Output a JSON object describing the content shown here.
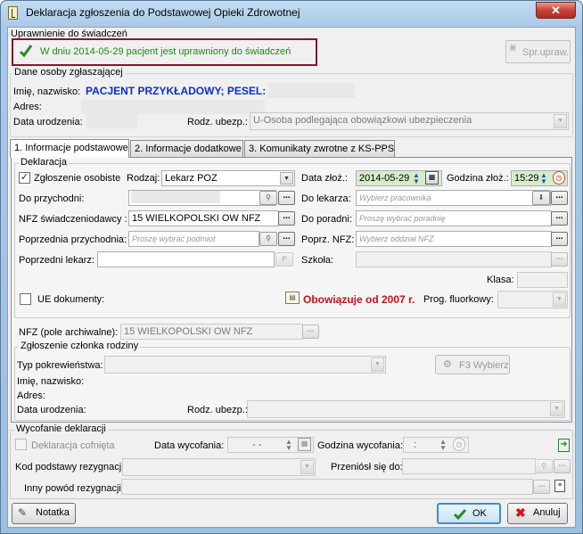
{
  "window": {
    "title": "Deklaracja zgłoszenia do Podstawowej Opieki Zdrowotnej",
    "close": "✕"
  },
  "uprawnienie": {
    "group": "Uprawnienie do świadczeń",
    "message": "W dniu 2014-05-29 pacjent jest uprawniony do świadczeń",
    "spr_button": "Spr.upraw."
  },
  "osoba": {
    "group": "Dane osoby zgłaszającej",
    "name_label": "Imię, nazwisko:",
    "name_value": "PACJENT PRZYKŁADOWY; PESEL:",
    "adres_label": "Adres:",
    "dob_label": "Data urodzenia:",
    "rodz_label": "Rodz. ubezp.:",
    "rodz_value": "U-Osoba podlegająca obowiązkowi ubezpieczenia"
  },
  "tabs": [
    "1. Informacje podstawowe",
    "2. Informacje dodatkowe",
    "3. Komunikaty zwrotne z KS-PPS"
  ],
  "deklaracja": {
    "group": "Deklaracja",
    "zgl_osobiste": "Zgłoszenie osobiste",
    "rodzaj_label": "Rodzaj:",
    "rodzaj_value": "Lekarz POZ",
    "data_zloz_label": "Data złoż.:",
    "data_zloz_value": "2014-05-29",
    "godzina_label": "Godzina złoż.:",
    "godzina_value": "15:29",
    "do_przych_label": "Do przychodni:",
    "do_lekarza_label": "Do lekarza:",
    "do_lekarza_ph": "Wybierz pracownika",
    "nfz_label": "NFZ świadczeniodawcy :",
    "nfz_value": "15 WIELKOPOLSKI OW NFZ",
    "do_poradni_label": "Do poradni:",
    "do_poradni_ph": "Proszę wybrać poradnię",
    "poprz_przych_label": "Poprzednia przychodnia:",
    "poprz_przych_ph": "Proszę wybrać podmiot",
    "poprz_nfz_label": "Poprz. NFZ:",
    "poprz_nfz_ph": "Wybierz oddział NFZ",
    "poprz_lekarz_label": "Poprzedni lekarz:",
    "szkola_label": "Szkoła:",
    "klasa_label": "Klasa:",
    "ue_label": "UE dokumenty:",
    "obowiazuje": "Obowiązuje od 2007 r.",
    "prog_label": "Prog. fluorkowy:",
    "nfz_arch_label": "NFZ (pole archiwalne):",
    "nfz_arch_value": "15 WIELKOPOLSKI OW NFZ"
  },
  "rodzina": {
    "group": "Zgłoszenie członka rodziny",
    "typ_label": "Typ pokrewieństwa:",
    "f3_button": "F3 Wybierz",
    "name_label": "Imię, nazwisko:",
    "adres_label": "Adres:",
    "dob_label": "Data urodzenia:",
    "rodz_label": "Rodz. ubezp.:"
  },
  "wycofanie": {
    "group": "Wycofanie deklaracji",
    "cofnieta": "Deklaracja cofnięta",
    "data_label": "Data wycofania:",
    "data_value": "-  -",
    "godzina_label": "Godzina wycofania:",
    "godzina_value": ":",
    "kod_label": "Kod podstawy rezygnacji:",
    "przeniosl_label": "Przeniósł się do:",
    "inny_label": "Inny powód rezygnacji:"
  },
  "footer": {
    "notatka": "Notatka",
    "ok": "OK",
    "anuluj": "Anuluj"
  },
  "colors": {
    "title_accent": "#1b8a12",
    "blue_name": "#0b2fc9",
    "red_note": "#c8101a",
    "border_highlight": "#7a1c2a"
  }
}
